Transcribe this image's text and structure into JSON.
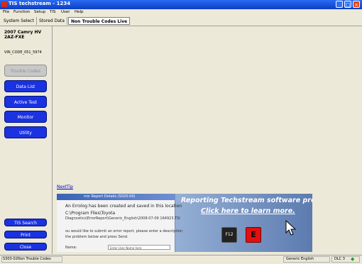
{
  "window": {
    "title": "TIS techstream - 1234"
  },
  "menu": [
    "File",
    "Function",
    "Setup",
    "TIS",
    "User",
    "Help"
  ],
  "tabs": [
    "System Select",
    "Stored Data",
    "Non Trouble Codes Live"
  ],
  "vehicle": {
    "model": "2007 Camry HV",
    "engine": "2AZ-FXE",
    "vin": "VIN_CODE_051_5974"
  },
  "sidebar_buttons": [
    "Trouble Codes",
    "Data List",
    "Active Test",
    "Monitor",
    "Utility"
  ],
  "bottom_buttons": [
    "TIS Search",
    "Print",
    "Close"
  ],
  "next_tip": "NextTip",
  "banner": {
    "report_title": "rror Report Details (S020-00)",
    "report_lines": [
      "An Errolog has been created and saved in this location",
      "C:\\Program Files\\Toyota",
      "Diagnostics\\ErrorReport\\Generic_English\\2008-07-09 164923.TSI",
      "ou would like to submit an error report, please enter a description",
      "the problem below and press Send.",
      "Name:"
    ],
    "name_placeholder": "Enter User Name here",
    "headline": "Reporting Techstream software problems is easy.",
    "subhead": "Click here to learn more.",
    "key_f12": "F12",
    "key_e": "E"
  },
  "status": {
    "code": "S303-02",
    "mode": "Non Trouble Codes",
    "language": "Generic English",
    "dlc": "DLC 3"
  }
}
